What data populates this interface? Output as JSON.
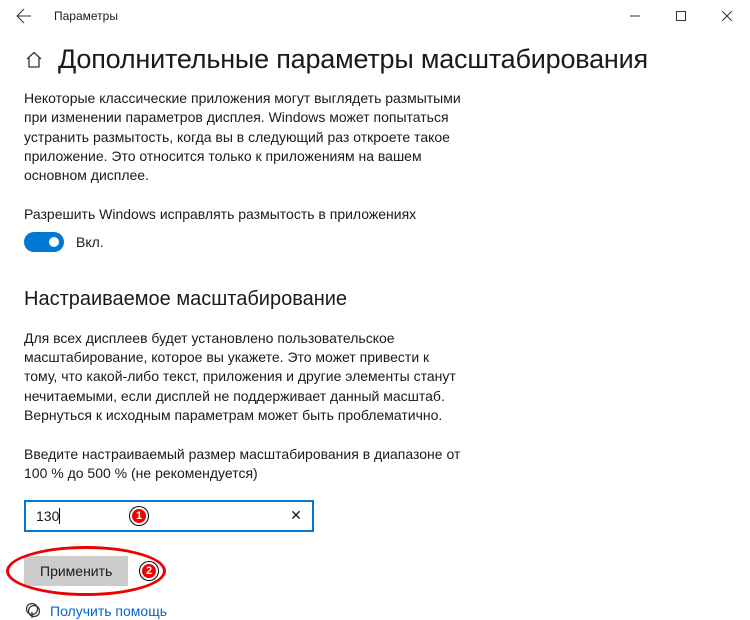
{
  "titlebar": {
    "app_name": "Параметры"
  },
  "header": {
    "page_title": "Дополнительные параметры масштабирования"
  },
  "section1": {
    "description": "Некоторые классические приложения могут выглядеть размытыми при изменении параметров дисплея. Windows может попытаться устранить размытость, когда вы в следующий раз откроете такое приложение. Это относится только к приложениям на вашем основном дисплее.",
    "toggle_label": "Разрешить Windows исправлять размытость в приложениях",
    "toggle_state": "Вкл."
  },
  "section2": {
    "title": "Настраиваемое масштабирование",
    "description": "Для всех дисплеев будет установлено пользовательское масштабирование, которое вы укажете. Это может привести к тому, что какой-либо текст, приложения и другие элементы станут нечитаемыми, если дисплей не поддерживает данный масштаб. Вернуться к исходным параметрам может быть проблематично.",
    "input_hint": "Введите настраиваемый размер масштабирования в диапазоне от 100 % до 500 % (не рекомендуется)",
    "input_value": "130",
    "apply_label": "Применить"
  },
  "help": {
    "link_text": "Получить помощь"
  },
  "annotations": {
    "marker1": "1",
    "marker2": "2"
  }
}
